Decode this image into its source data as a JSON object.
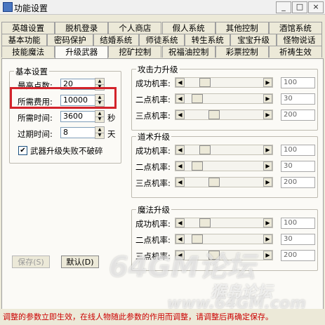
{
  "window": {
    "title": "功能设置",
    "min": "_",
    "max": "□",
    "close": "×"
  },
  "tab_rows": [
    [
      "英雄设置",
      "脱机登录",
      "个人商店",
      "假人系统",
      "其他控制",
      "酒馆系统"
    ],
    [
      "基本功能",
      "密码保护",
      "结婚系统",
      "师徒系统",
      "转生系统",
      "宝宝升级",
      "怪物说话"
    ],
    [
      "技能魔法",
      "升级武器",
      "挖矿控制",
      "祝福油控制",
      "彩票控制",
      "祈祷生效"
    ]
  ],
  "active_tab": "升级武器",
  "basic": {
    "legend": "基本设置",
    "max_points_label": "最高点数:",
    "max_points_value": "20",
    "cost_label": "所需费用:",
    "cost_value": "10000",
    "time_label": "所需时间:",
    "time_value": "3600",
    "time_unit": "秒",
    "expire_label": "过期时间:",
    "expire_value": "8",
    "expire_unit": "天",
    "no_break_label": "武器升级失败不破碎",
    "no_break_checked": true
  },
  "slider_labels": {
    "success": "成功机率:",
    "two": "二点机率:",
    "three": "三点机率:"
  },
  "groups": [
    {
      "key": "attack",
      "legend": "攻击力升级",
      "rows": [
        {
          "value": "100",
          "level": 0.22
        },
        {
          "value": "30",
          "level": 0.1
        },
        {
          "value": "200",
          "level": 0.35
        }
      ]
    },
    {
      "key": "tao",
      "legend": "道术升级",
      "rows": [
        {
          "value": "100",
          "level": 0.22
        },
        {
          "value": "30",
          "level": 0.1
        },
        {
          "value": "200",
          "level": 0.35
        }
      ]
    },
    {
      "key": "magic",
      "legend": "魔法升级",
      "rows": [
        {
          "value": "100",
          "level": 0.22
        },
        {
          "value": "30",
          "level": 0.1
        },
        {
          "value": "200",
          "level": 0.35
        }
      ]
    }
  ],
  "buttons": {
    "save": "保存(S)",
    "default": "默认(D)"
  },
  "status_text": "调整的参数立即生效，在线人物随此参数的作用而调整，请调整后再确定保存。",
  "watermark": {
    "forum": "64GM论坛",
    "url": "www.64GM.com",
    "mascot": "猴岛论坛"
  },
  "colors": {
    "highlight_box": "#d3232b",
    "status_text": "#cc0000",
    "bg": "#ece9d8"
  }
}
